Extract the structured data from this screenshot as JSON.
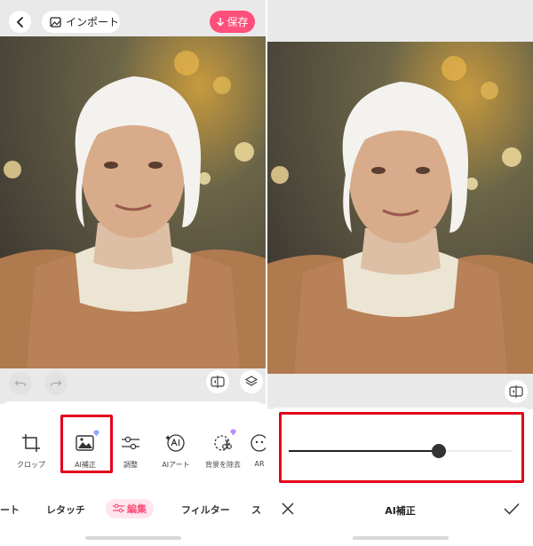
{
  "left": {
    "topbar": {
      "import_label": "インポート",
      "save_label": "保存"
    },
    "tools": [
      {
        "label": "クロップ",
        "icon": "crop-icon"
      },
      {
        "label": "AI補正",
        "icon": "ai-enhance-icon",
        "premium": true
      },
      {
        "label": "調整",
        "icon": "adjust-sliders-icon"
      },
      {
        "label": "AIアート",
        "icon": "ai-art-icon"
      },
      {
        "label": "背景を除去",
        "icon": "background-remove-icon",
        "premium": true
      },
      {
        "label": "AR",
        "icon": "ar-icon"
      }
    ],
    "tabs": [
      {
        "label": "ート"
      },
      {
        "label": "レタッチ"
      },
      {
        "label": "編集",
        "active": true
      },
      {
        "label": "フィルター"
      },
      {
        "label": "ス"
      }
    ]
  },
  "right": {
    "slider_level": 0.67,
    "title": "AI補正"
  },
  "colors": {
    "accent": "#ff4f7b",
    "highlight": "#e3001b",
    "bar_bg": "#e9e9e9"
  }
}
